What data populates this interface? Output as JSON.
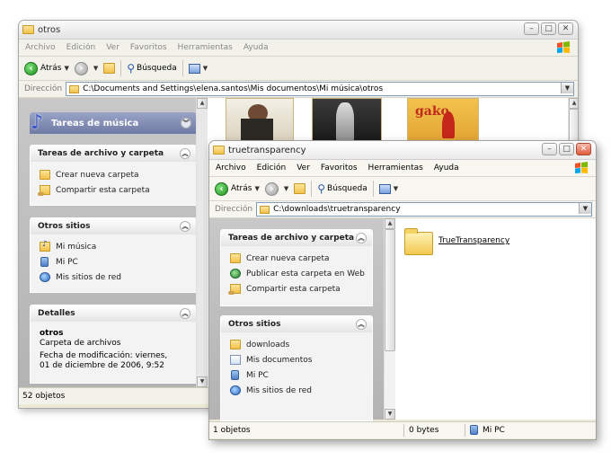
{
  "back_window": {
    "title": "otros",
    "menu": [
      "Archivo",
      "Edición",
      "Ver",
      "Favoritos",
      "Herramientas",
      "Ayuda"
    ],
    "toolbar": {
      "back": "Atrás",
      "search": "Búsqueda"
    },
    "address": {
      "label": "Dirección",
      "path": "C:\\Documents and Settings\\elena.santos\\Mis documentos\\Mi música\\otros"
    },
    "music_tasks": {
      "title": "Tareas de música"
    },
    "file_tasks": {
      "title": "Tareas de archivo y carpeta",
      "items": [
        "Crear nueva carpeta",
        "Compartir esta carpeta"
      ]
    },
    "other_places": {
      "title": "Otros sitios",
      "items": [
        "Mi música",
        "Mi PC",
        "Mis sitios de red"
      ]
    },
    "details": {
      "title": "Detalles",
      "name": "otros",
      "type": "Carpeta de archivos",
      "modified": "Fecha de modificación: viernes, 01 de diciembre de 2006, 9:52"
    },
    "status": {
      "objects": "52 objetos"
    }
  },
  "front_window": {
    "title": "truetransparency",
    "menu": [
      "Archivo",
      "Edición",
      "Ver",
      "Favoritos",
      "Herramientas",
      "Ayuda"
    ],
    "toolbar": {
      "back": "Atrás",
      "search": "Búsqueda"
    },
    "address": {
      "label": "Dirección",
      "path": "C:\\downloads\\truetransparency"
    },
    "file_tasks": {
      "title": "Tareas de archivo y carpeta",
      "items": [
        "Crear nueva carpeta",
        "Publicar esta carpeta en Web",
        "Compartir esta carpeta"
      ]
    },
    "other_places": {
      "title": "Otros sitios",
      "items": [
        "downloads",
        "Mis documentos",
        "Mi PC",
        "Mis sitios de red"
      ]
    },
    "folder_item": {
      "name": "TrueTransparency"
    },
    "status": {
      "objects": "1 objetos",
      "size": "0 bytes",
      "location": "Mi PC"
    }
  }
}
